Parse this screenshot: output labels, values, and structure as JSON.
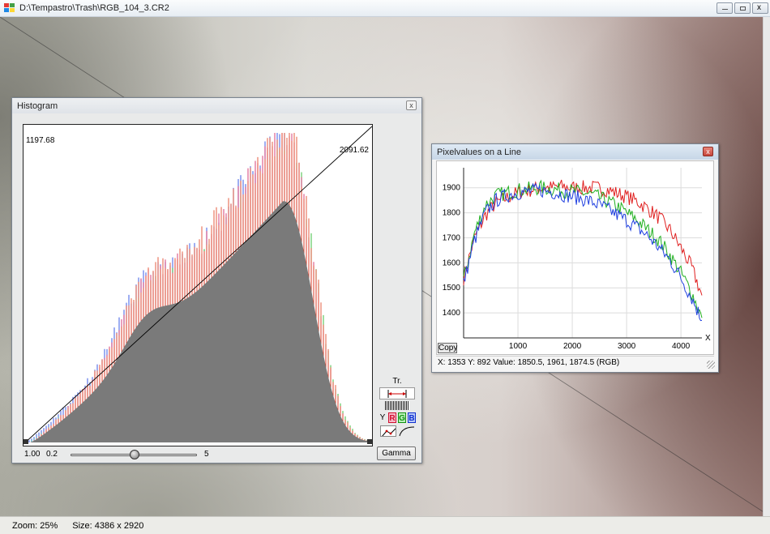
{
  "window": {
    "title": "D:\\Tempastro\\Trash\\RGB_104_3.CR2"
  },
  "status": {
    "zoom": "Zoom: 25%",
    "size": "Size: 4386 x 2920"
  },
  "histogram": {
    "title": "Histogram",
    "close": "x",
    "peak_label": "1197.68",
    "right_label": "2091.62",
    "min_value": "1.00",
    "slider_min": "0.2",
    "slider_max": "5",
    "tr_label": "Tr.",
    "channels": [
      "Y",
      "R",
      "G",
      "B"
    ],
    "gamma_button": "Gamma",
    "slider_value_fraction": 0.47
  },
  "profile": {
    "title": "Pixelvalues on a Line",
    "close": "x",
    "copy_button": "Copy",
    "status": "X: 1353  Y: 892  Value: 1850.5, 1961, 1874.5 (RGB)"
  },
  "chart_data": [
    {
      "type": "line",
      "title": "Pixelvalues on a Line",
      "xlabel": "X",
      "ylabel": "",
      "xlim": [
        0,
        4386
      ],
      "ylim": [
        1300,
        1980
      ],
      "x_ticks": [
        1000,
        2000,
        3000,
        4000
      ],
      "y_ticks": [
        1400,
        1500,
        1600,
        1700,
        1800,
        1900
      ],
      "grid": true,
      "x": [
        0,
        200,
        400,
        600,
        800,
        1000,
        1200,
        1400,
        1600,
        1800,
        2000,
        2200,
        2400,
        2600,
        2800,
        3000,
        3200,
        3400,
        3600,
        3800,
        4000,
        4200,
        4386
      ],
      "series": [
        {
          "color": "#e02020",
          "values": [
            1540,
            1700,
            1790,
            1840,
            1860,
            1880,
            1890,
            1900,
            1900,
            1905,
            1900,
            1900,
            1900,
            1895,
            1880,
            1865,
            1845,
            1815,
            1780,
            1730,
            1660,
            1580,
            1470
          ]
        },
        {
          "color": "#20b020",
          "values": [
            1530,
            1720,
            1830,
            1870,
            1880,
            1890,
            1895,
            1900,
            1895,
            1890,
            1885,
            1880,
            1870,
            1850,
            1830,
            1800,
            1770,
            1730,
            1690,
            1630,
            1560,
            1480,
            1380
          ]
        },
        {
          "color": "#2040e0",
          "values": [
            1520,
            1690,
            1800,
            1850,
            1870,
            1880,
            1885,
            1890,
            1885,
            1875,
            1865,
            1855,
            1840,
            1820,
            1795,
            1770,
            1740,
            1705,
            1660,
            1610,
            1540,
            1460,
            1370
          ]
        }
      ]
    },
    {
      "type": "area",
      "title": "Histogram",
      "peak": "1197.68",
      "right_marker": "2091.62",
      "grid": false,
      "channels": [
        "Y",
        "R",
        "G",
        "B"
      ]
    }
  ]
}
